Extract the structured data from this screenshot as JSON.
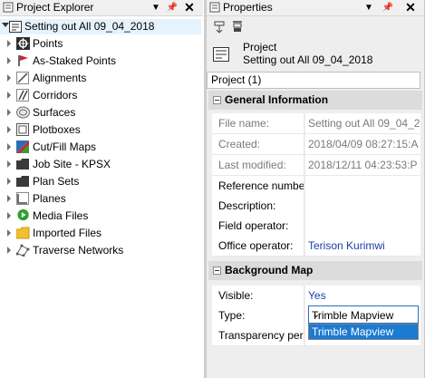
{
  "explorer": {
    "title": "Project Explorer",
    "root_label": "Setting out All 09_04_2018",
    "items": [
      {
        "label": "Points",
        "icon": "points-icon"
      },
      {
        "label": "As-Staked Points",
        "icon": "flag-icon"
      },
      {
        "label": "Alignments",
        "icon": "alignment-icon"
      },
      {
        "label": "Corridors",
        "icon": "corridor-icon"
      },
      {
        "label": "Surfaces",
        "icon": "surface-icon"
      },
      {
        "label": "Plotboxes",
        "icon": "plotbox-icon"
      },
      {
        "label": "Cut/Fill Maps",
        "icon": "cutfill-map-icon"
      },
      {
        "label": "Job Site - KPSX",
        "icon": "folder-icon"
      },
      {
        "label": "Plan Sets",
        "icon": "folder-icon"
      },
      {
        "label": "Planes",
        "icon": "plane-icon"
      },
      {
        "label": "Media Files",
        "icon": "media-play-icon"
      },
      {
        "label": "Imported Files",
        "icon": "folder-icon"
      },
      {
        "label": "Traverse Networks",
        "icon": "network-icon"
      }
    ]
  },
  "properties": {
    "title": "Properties",
    "header_kind": "Project",
    "header_name": "Setting out All 09_04_2018",
    "object_combo": "Project (1)",
    "sections": {
      "general": {
        "title": "General Information",
        "rows": [
          {
            "name": "File name:",
            "value": "Setting out All 09_04_2"
          },
          {
            "name": "Created:",
            "value": "2018/04/09 08:27:15:A"
          },
          {
            "name": "Last modified:",
            "value": "2018/12/11 04:23:53:P"
          },
          {
            "name": "Reference number:",
            "value": ""
          },
          {
            "name": "Description:",
            "value": ""
          },
          {
            "name": "Field operator:",
            "value": ""
          },
          {
            "name": "Office operator:",
            "value": "Terison Kurimwi"
          }
        ]
      },
      "background_map": {
        "title": "Background Map",
        "visible_label": "Visible:",
        "visible_value": "Yes",
        "type_label": "Type:",
        "type_value": "Trimble Mapview",
        "type_options": [
          "Trimble Mapview"
        ],
        "transparency_label": "Transparency perc"
      }
    }
  },
  "colors": {
    "accent": "#1b7ad1",
    "link_blue": "#1c3ea6",
    "selection": "#e5f3ff"
  }
}
